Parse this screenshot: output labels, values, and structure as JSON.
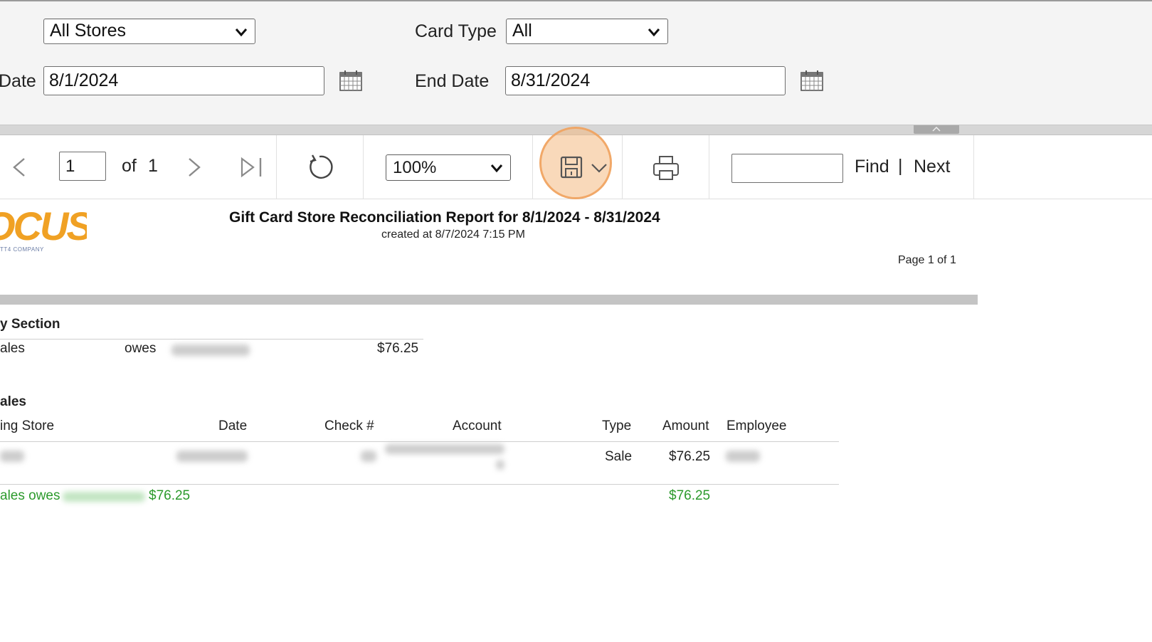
{
  "params": {
    "store_select": "All Stores",
    "card_type_label": "Card Type",
    "card_type_select": "All",
    "start_date_label": "Date",
    "start_date_value": "8/1/2024",
    "end_date_label": "End Date",
    "end_date_value": "8/31/2024"
  },
  "toolbar": {
    "page_current": "1",
    "of_label": "of",
    "page_total": "1",
    "zoom_value": "100%",
    "find_label": "Find",
    "divider": "|",
    "next_label": "Next",
    "icons": [
      "prev-page-icon",
      "next-page-icon",
      "last-page-icon",
      "refresh-icon",
      "save-export-icon",
      "dropdown-chevron-icon",
      "print-icon"
    ]
  },
  "report": {
    "logo_text": "OCUS",
    "logo_subtext": "TT4 COMPANY",
    "title": "Gift Card Store Reconciliation Report for 8/1/2024 - 8/31/2024",
    "created": "created at 8/7/2024 7:15 PM",
    "page_info": "Page 1 of 1",
    "summary": {
      "heading": "y Section",
      "row_col1": "ales",
      "row_owes": "owes",
      "row_amount": "$76.25"
    },
    "sales": {
      "heading": "ales",
      "columns": [
        "ing Store",
        "Date",
        "Check #",
        "Account",
        "Type",
        "Amount",
        "Employee"
      ],
      "row": {
        "type": "Sale",
        "amount": "$76.25"
      },
      "total_prefix": "ales owes",
      "total_amount_left": "$76.25",
      "total_amount_right": "$76.25"
    }
  },
  "colors": {
    "accent_orange": "#f0a124",
    "highlight_ring": "#f4b981",
    "total_green": "#2c9a2c"
  }
}
